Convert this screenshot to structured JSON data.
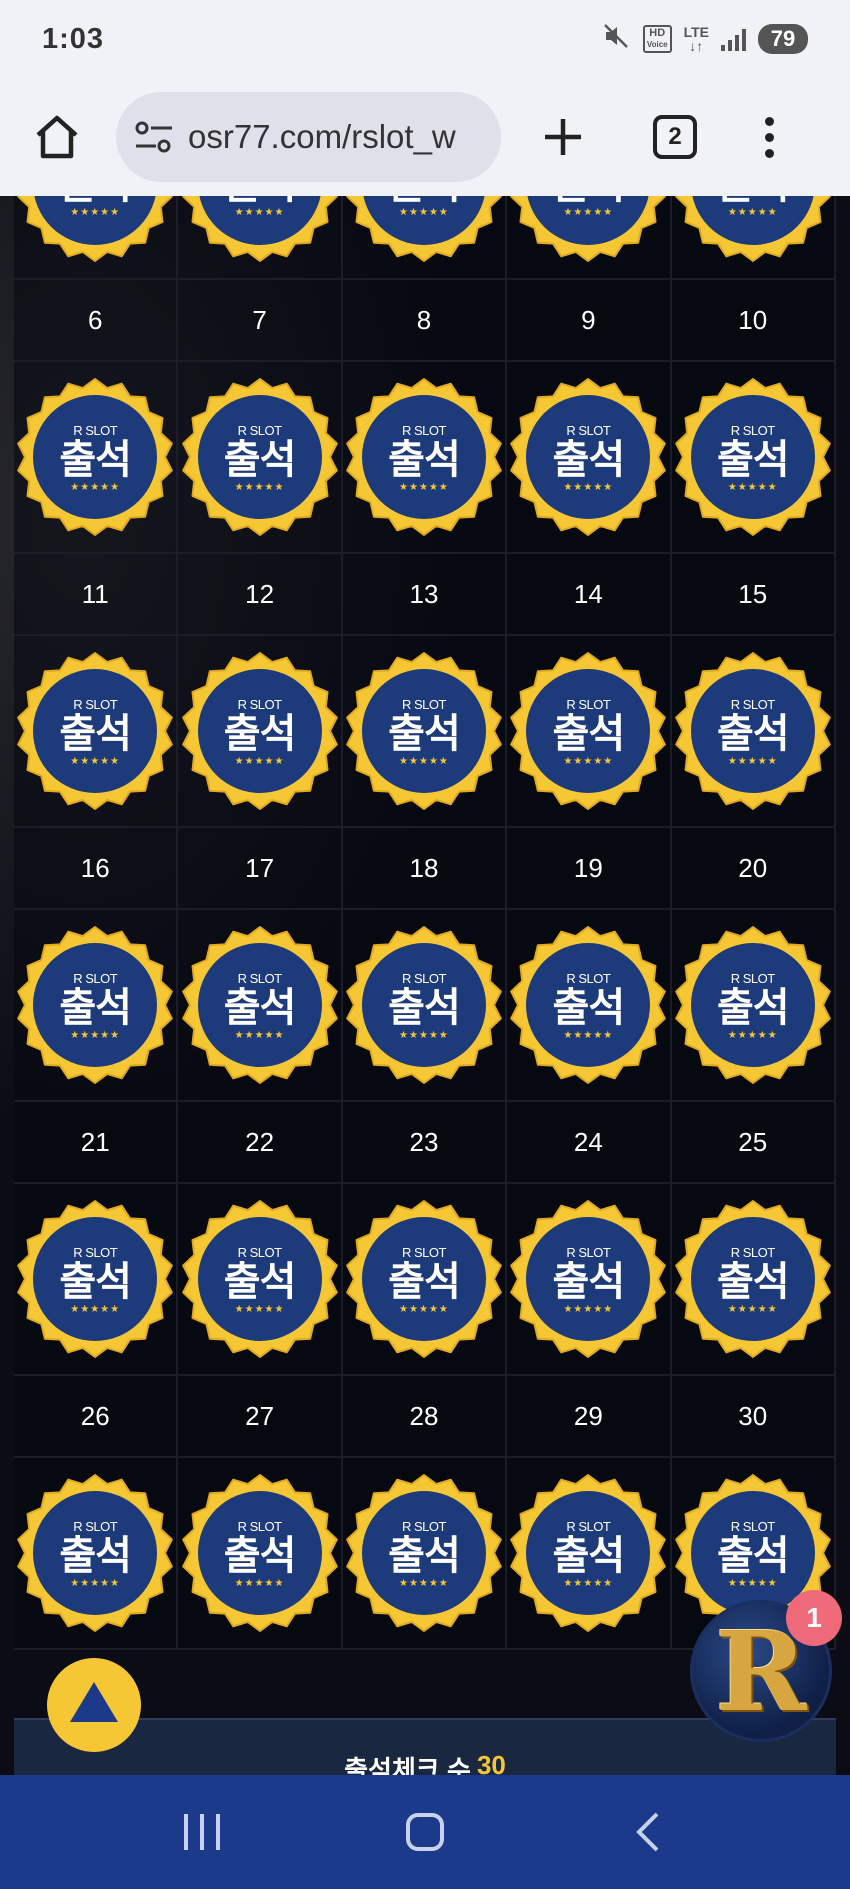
{
  "status_bar": {
    "time": "1:03",
    "hd_label": "HD",
    "voice_label": "Voice",
    "lte_label": "LTE",
    "battery": "79"
  },
  "browser": {
    "url": "osr77.com/rslot_w",
    "tab_count": "2"
  },
  "calendar": {
    "badge_brand": "R SLOT",
    "badge_text": "출석",
    "badge_stars": "★★★★★",
    "rows": [
      {
        "days": [
          "6",
          "7",
          "8",
          "9",
          "10"
        ]
      },
      {
        "days": [
          "11",
          "12",
          "13",
          "14",
          "15"
        ]
      },
      {
        "days": [
          "16",
          "17",
          "18",
          "19",
          "20"
        ]
      },
      {
        "days": [
          "21",
          "22",
          "23",
          "24",
          "25"
        ]
      },
      {
        "days": [
          "26",
          "27",
          "28",
          "29",
          "30"
        ]
      }
    ]
  },
  "banner": {
    "label": "출석체크 수",
    "count": "30"
  },
  "chat": {
    "letter": "R",
    "notification_count": "1"
  },
  "colors": {
    "badge_gold": "#f6c735",
    "badge_navy": "#1d3a7a",
    "navbar": "#1b3a8c"
  }
}
